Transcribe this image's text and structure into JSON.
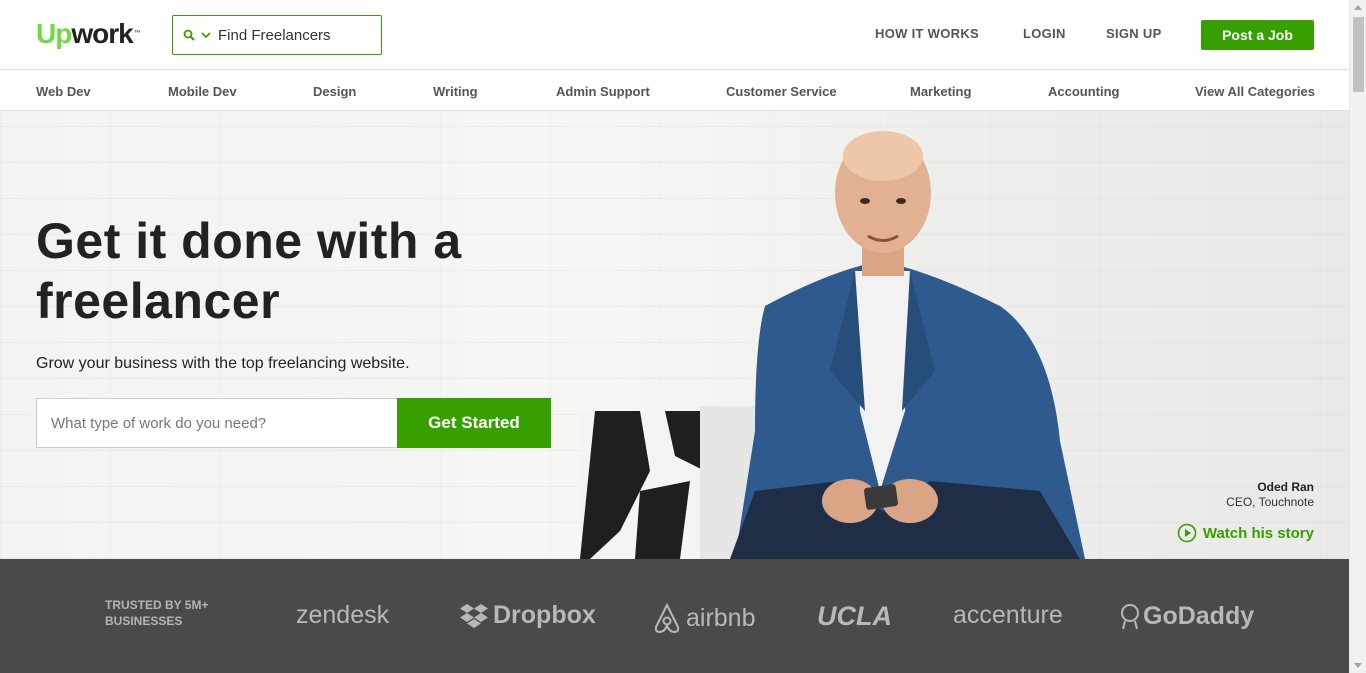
{
  "header": {
    "logo_up": "Up",
    "logo_work": "work",
    "logo_tm": "™",
    "search_label": "Find Freelancers",
    "nav": [
      "HOW IT WORKS",
      "LOGIN",
      "SIGN UP"
    ],
    "post_job": "Post a Job"
  },
  "categories": [
    "Web Dev",
    "Mobile Dev",
    "Design",
    "Writing",
    "Admin Support",
    "Customer Service",
    "Marketing",
    "Accounting",
    "View All Categories"
  ],
  "hero": {
    "title": "Get it done with a freelancer",
    "subtitle": "Grow your business with the top freelancing website.",
    "input_placeholder": "What type of work do you need?",
    "cta": "Get Started",
    "person_name": "Oded Ran",
    "person_role": "CEO, Touchnote",
    "watch_label": "Watch his story"
  },
  "trusted": {
    "label": "TRUSTED BY 5M+ BUSINESSES",
    "brands": [
      "zendesk",
      "Dropbox",
      "airbnb",
      "UCLA",
      "accenture",
      "GoDaddy"
    ]
  },
  "colors": {
    "brand_green": "#37a000",
    "logo_green": "#6fda44",
    "strip_gray": "#4a4a4a"
  },
  "icons": {
    "search": "search-icon",
    "dropdown": "chevron-down-icon",
    "play": "play-circle-icon"
  }
}
